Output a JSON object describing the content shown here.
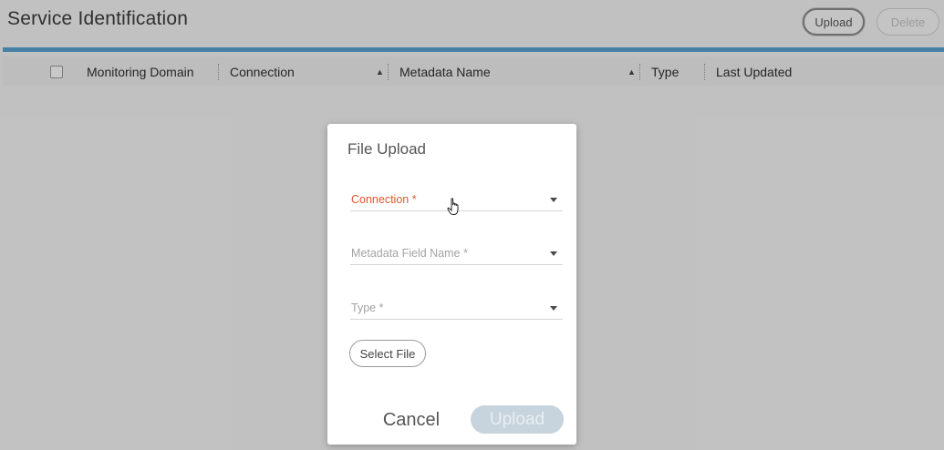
{
  "header": {
    "title": "Service Identification",
    "upload_label": "Upload",
    "delete_label": "Delete"
  },
  "table": {
    "columns": [
      "Monitoring Domain",
      "Connection",
      "Metadata Name",
      "Type",
      "Last Updated"
    ],
    "sort_indicator": "▲"
  },
  "dialog": {
    "title": "File Upload",
    "fields": [
      {
        "label": "Connection *",
        "state": "active"
      },
      {
        "label": "Metadata Field Name *",
        "state": "normal"
      },
      {
        "label": "Type *",
        "state": "normal"
      }
    ],
    "select_file_label": "Select File",
    "cancel_label": "Cancel",
    "upload_label": "Upload"
  },
  "colors": {
    "accent_bar": "#5aa2d3",
    "active_field_label": "#e0572f",
    "disabled_upload_bg": "#c7d3dd"
  },
  "icons": {
    "cursor": "hand-pointer-icon",
    "dropdown": "chevron-down-icon",
    "sort": "sort-ascending-icon"
  }
}
